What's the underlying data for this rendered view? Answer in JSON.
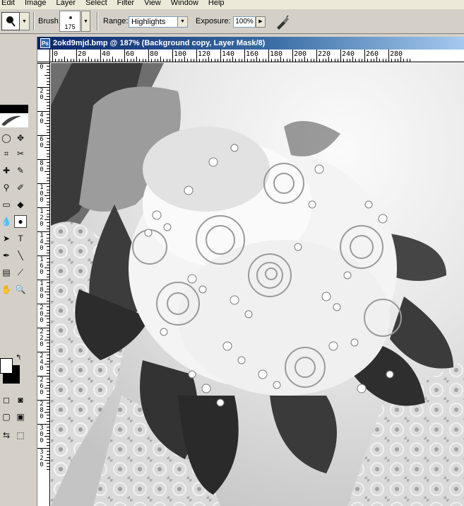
{
  "menu": {
    "items": [
      "Edit",
      "Image",
      "Layer",
      "Select",
      "Filter",
      "View",
      "Window",
      "Help"
    ]
  },
  "options": {
    "brush_label": "Brush:",
    "brush_size": "175",
    "range_label": "Range:",
    "range_value": "Highlights",
    "exposure_label": "Exposure:",
    "exposure_value": "100%"
  },
  "document": {
    "title": "2okd9mjd.bmp @ 187% (Background copy, Layer Mask/8)",
    "ruler_h": [
      "0",
      "20",
      "40",
      "60",
      "80",
      "100",
      "120",
      "140",
      "160",
      "180",
      "200",
      "220",
      "240",
      "260",
      "280"
    ],
    "ruler_v": [
      "0",
      "2 0",
      "4 0",
      "6 0",
      "8 0",
      "1 0 0",
      "1 2 0",
      "1 4 0",
      "1 6 0",
      "1 8 0",
      "2 0 0",
      "2 2 0",
      "2 4 0",
      "2 6 0",
      "2 8 0",
      "3 0 0",
      "3 2 0"
    ]
  },
  "icons": {
    "tool_preset": "dodge-tool-icon",
    "airbrush": "airbrush-icon",
    "title_icon": "photoshop-doc-icon"
  },
  "colors": {
    "title_start": "#0a246a",
    "title_end": "#a6caf0",
    "foreground": "#ffffff",
    "background": "#000000"
  }
}
